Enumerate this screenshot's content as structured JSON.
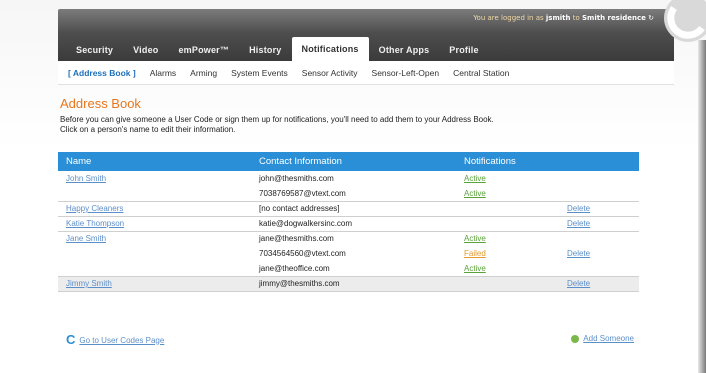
{
  "header": {
    "login_prefix": "You are logged in as",
    "username": "jsmith",
    "login_to": "to",
    "residence": "Smith residence",
    "residence_icon": "refresh-icon"
  },
  "tabs": [
    {
      "label": "Security",
      "active": false
    },
    {
      "label": "Video",
      "active": false
    },
    {
      "label": "emPower™",
      "active": false
    },
    {
      "label": "History",
      "active": false
    },
    {
      "label": "Notifications",
      "active": true
    },
    {
      "label": "Other Apps",
      "active": false
    },
    {
      "label": "Profile",
      "active": false
    }
  ],
  "subnav": [
    {
      "label": "[ Address Book ]",
      "active": true
    },
    {
      "label": "Alarms",
      "active": false
    },
    {
      "label": "Arming",
      "active": false
    },
    {
      "label": "System Events",
      "active": false
    },
    {
      "label": "Sensor Activity",
      "active": false
    },
    {
      "label": "Sensor-Left-Open",
      "active": false
    },
    {
      "label": "Central Station",
      "active": false
    }
  ],
  "page": {
    "title": "Address Book",
    "intro_line1": "Before you can give someone a User Code or sign them up for notifications, you'll need to add them to your Address Book.",
    "intro_line2": "Click on a person's name to edit their information."
  },
  "table": {
    "headers": [
      "Name",
      "Contact Information",
      "Notifications",
      ""
    ],
    "rows": [
      {
        "name": "John Smith",
        "contact": "john@thesmiths.com",
        "status": "Active",
        "status_type": "active",
        "action": "",
        "shade": false,
        "group_end": false
      },
      {
        "name": "",
        "contact": "7038769587@vtext.com",
        "status": "Active",
        "status_type": "active",
        "action": "",
        "shade": false,
        "group_end": true
      },
      {
        "name": "Happy Cleaners",
        "contact": "[no contact addresses]",
        "status": "",
        "status_type": "",
        "action": "Delete",
        "shade": false,
        "group_end": true
      },
      {
        "name": "Katie Thompson",
        "contact": "katie@dogwalkersinc.com",
        "status": "",
        "status_type": "",
        "action": "Delete",
        "shade": false,
        "group_end": true
      },
      {
        "name": "Jane Smith",
        "contact": "jane@thesmiths.com",
        "status": "Active",
        "status_type": "active",
        "action": "",
        "shade": false,
        "group_end": false
      },
      {
        "name": "",
        "contact": "7034564560@vtext.com",
        "status": "Failed",
        "status_type": "failed",
        "action": "Delete",
        "shade": false,
        "group_end": false
      },
      {
        "name": "",
        "contact": "jane@theoffice.com",
        "status": "Active",
        "status_type": "active",
        "action": "",
        "shade": false,
        "group_end": true
      },
      {
        "name": "Jimmy Smith",
        "contact": "jimmy@thesmiths.com",
        "status": "",
        "status_type": "",
        "action": "Delete",
        "shade": true,
        "group_end": true
      }
    ]
  },
  "footer": {
    "back_label": "Go to User Codes Page",
    "back_icon": "c-logo-icon",
    "add_label": "Add Someone",
    "add_icon": "plus-circle-icon"
  },
  "colors": {
    "header_blue": "#2a8fd6",
    "title_orange": "#e8761e",
    "active_green": "#5aa33a",
    "failed_orange": "#e39a2e",
    "link_blue": "#5b8fc9"
  }
}
